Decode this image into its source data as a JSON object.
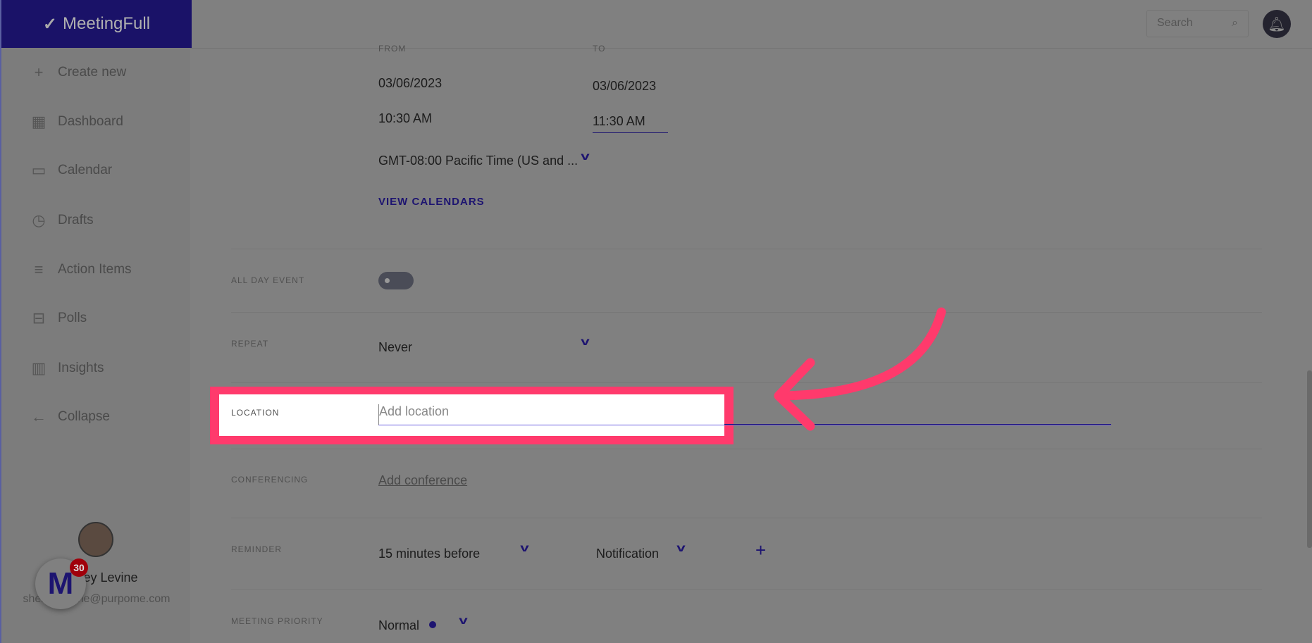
{
  "app": {
    "name": "MeetingFull"
  },
  "sidebar": {
    "items": [
      {
        "label": "Create new",
        "icon": "plus-icon"
      },
      {
        "label": "Dashboard",
        "icon": "grid-icon"
      },
      {
        "label": "Calendar",
        "icon": "calendar-icon"
      },
      {
        "label": "Drafts",
        "icon": "clock-icon"
      },
      {
        "label": "Action Items",
        "icon": "list-icon"
      },
      {
        "label": "Polls",
        "icon": "poll-icon"
      },
      {
        "label": "Insights",
        "icon": "bar-chart-icon"
      },
      {
        "label": "Collapse",
        "icon": "arrow-left-icon"
      }
    ],
    "user": {
      "name": "Shelley Levine",
      "email": "shelley.levine@purpome.com"
    },
    "fab_badge": "30"
  },
  "header": {
    "search_placeholder": "Search"
  },
  "form": {
    "from_label": "FROM",
    "to_label": "TO",
    "from_date": "03/06/2023",
    "to_date": "03/06/2023",
    "from_time": "10:30 AM",
    "to_time": "11:30 AM",
    "timezone": "GMT-08:00 Pacific Time (US and ...",
    "view_calendars": "VIEW CALENDARS",
    "all_day_label": "ALL DAY EVENT",
    "all_day_on": false,
    "repeat_label": "REPEAT",
    "repeat_value": "Never",
    "location_label": "LOCATION",
    "location_placeholder": "Add location",
    "conferencing_label": "CONFERENCING",
    "conferencing_link": "Add conference",
    "reminder_label": "REMINDER",
    "reminder_time": "15 minutes before",
    "reminder_type": "Notification",
    "priority_label": "MEETING PRIORITY",
    "priority_value": "Normal"
  },
  "colors": {
    "accent": "#1d1470",
    "highlight": "#ff3a6c"
  }
}
